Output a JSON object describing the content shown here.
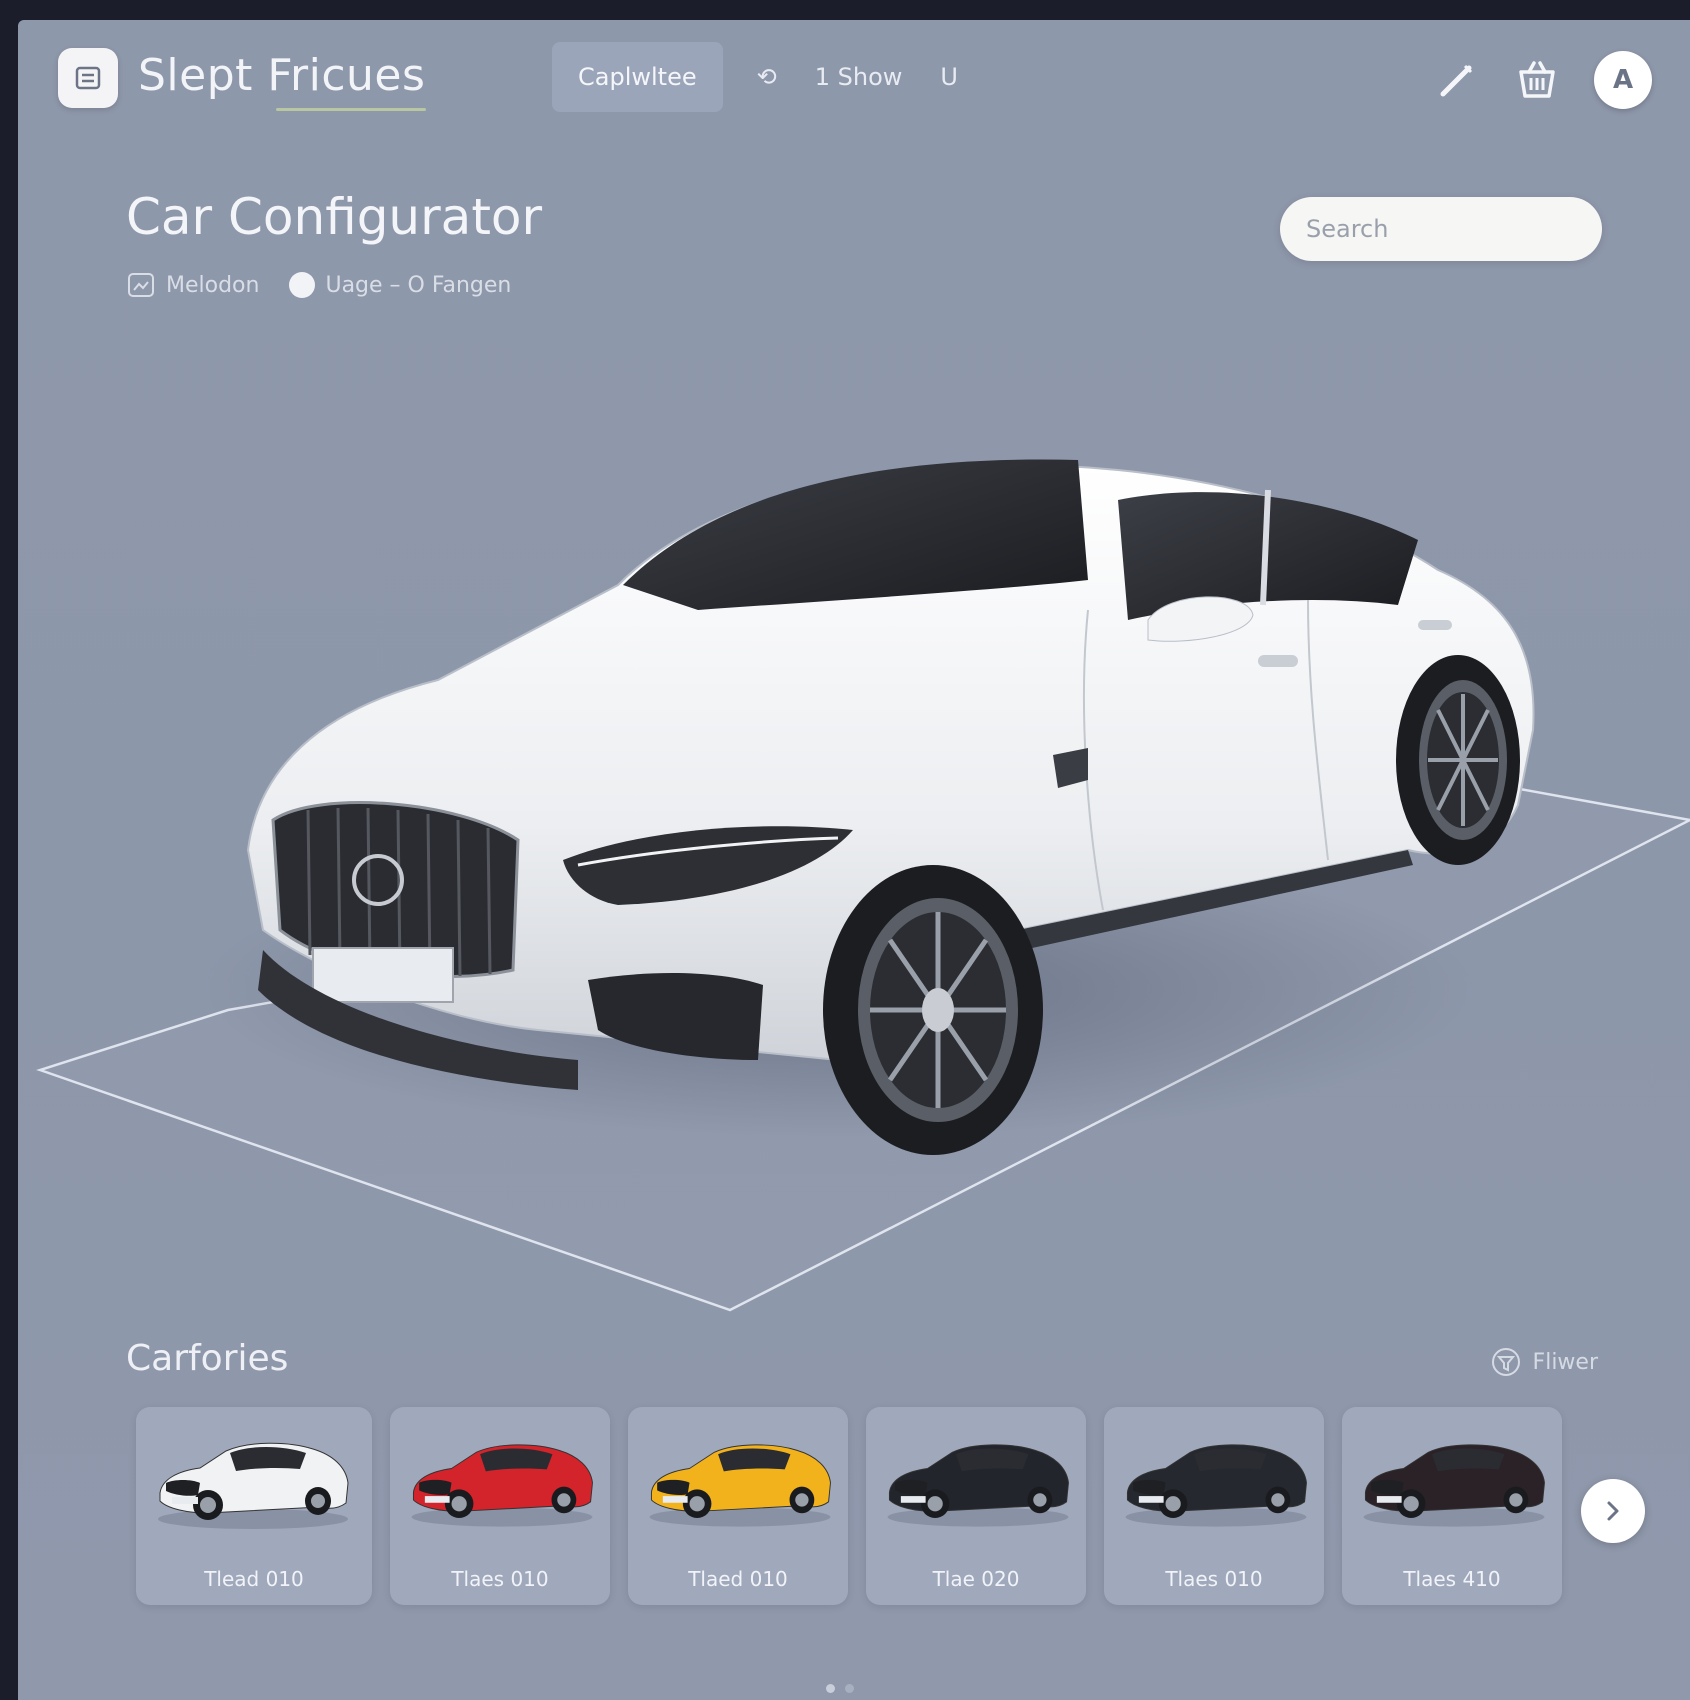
{
  "app": {
    "brand": "Slept Fricues"
  },
  "nav": {
    "tabs": [
      {
        "label": "Caplwltee",
        "active": true
      },
      {
        "label": "⟲",
        "active": false
      },
      {
        "label": "1 Show",
        "active": false
      },
      {
        "label": "U",
        "active": false
      }
    ]
  },
  "header": {
    "title": "Car Configurator",
    "meta_1": "Melodon",
    "meta_2": "Uage – O Fangen",
    "search_placeholder": "Search"
  },
  "stage": {
    "selected_color": "#eef0f2"
  },
  "categories": {
    "title": "Carfories",
    "filter_label": "Fliwer",
    "items": [
      {
        "label": "Tlead 010",
        "color": "#f1f2f4"
      },
      {
        "label": "Tlaes 010",
        "color": "#d3232b"
      },
      {
        "label": "Tlaed 010",
        "color": "#f2b21c"
      },
      {
        "label": "Tlae 020",
        "color": "#23252c"
      },
      {
        "label": "Tlaes 010",
        "color": "#25282e"
      },
      {
        "label": "Tlaes 410",
        "color": "#2a2226"
      }
    ]
  },
  "icons": {
    "logo": "list-icon",
    "edit": "pencil-icon",
    "basket": "basket-icon",
    "profile": "A"
  }
}
